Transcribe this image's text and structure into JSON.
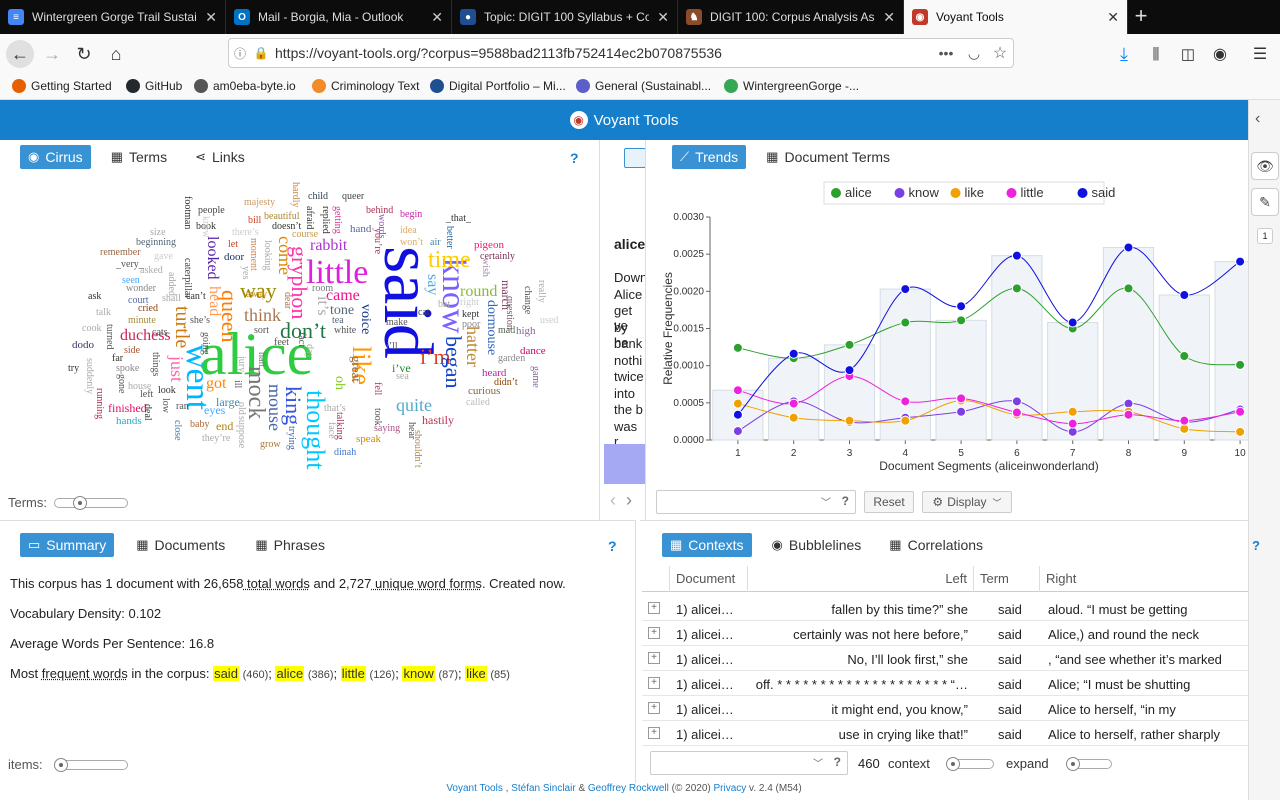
{
  "browser": {
    "tabs": [
      {
        "title": "Wintergreen Gorge Trail Sustain",
        "icon": "docs-icon",
        "color": "#4285f4",
        "glyph": "≡"
      },
      {
        "title": "Mail - Borgia, Mia - Outlook",
        "icon": "outlook-icon",
        "color": "#0072c6",
        "glyph": "O"
      },
      {
        "title": "Topic: DIGIT 100 Syllabus + Co",
        "icon": "globe-icon",
        "color": "#1d4f91",
        "glyph": "●"
      },
      {
        "title": "DIGIT 100: Corpus Analysis Ass",
        "icon": "horse-icon",
        "color": "#8a4b2a",
        "glyph": "♞"
      },
      {
        "title": "Voyant Tools",
        "icon": "voyant-icon",
        "color": "#c0392b",
        "glyph": "◉"
      }
    ],
    "url": "https://voyant-tools.org/?corpus=9588bad2113fb752414ec2b070875536",
    "bookmarks": [
      {
        "label": "Getting Started",
        "color": "#e66000"
      },
      {
        "label": "GitHub",
        "color": "#24292e"
      },
      {
        "label": "am0eba-byte.io",
        "color": "#555555"
      },
      {
        "label": "Criminology Text",
        "color": "#f28c28"
      },
      {
        "label": "Digital Portfolio – Mi...",
        "color": "#1d4f91"
      },
      {
        "label": "General (Sustainabl...",
        "color": "#5b5fc7"
      },
      {
        "label": "WintergreenGorge -...",
        "color": "#34a853"
      }
    ]
  },
  "voyant": {
    "title": "Voyant Tools",
    "accent": "#157fcc",
    "cirrus_panel": {
      "tabs": [
        "Cirrus",
        "Terms",
        "Links"
      ],
      "terms_label": "Terms:"
    },
    "reader_panel": {
      "heading": "alice",
      "lines": [
        "Down",
        "Alice",
        "get ve",
        "by he",
        "bank",
        "nothi",
        "twice",
        "into",
        "the b",
        "was r"
      ]
    },
    "trends_panel": {
      "tabs": [
        "Trends",
        "Document Terms"
      ],
      "reset_label": "Reset",
      "display_label": "Display"
    },
    "summary_panel": {
      "tabs": [
        "Summary",
        "Documents",
        "Phrases"
      ],
      "line1_a": "This corpus has 1 document with ",
      "line1_total": "26,658",
      "line1_b": " total words",
      "line1_c": " and ",
      "line1_unique": "2,727",
      "line1_d": " unique word forms",
      "line1_e": ". Created now.",
      "density_label": "Vocabulary Density:",
      "density_value": "0.102",
      "awps_label": "Average Words Per Sentence:",
      "awps_value": "16.8",
      "freq_a": "Most ",
      "freq_b": "frequent words",
      "freq_c": " in the corpus:",
      "freq_words": [
        {
          "word": "said",
          "count": "(460)"
        },
        {
          "word": "alice",
          "count": "(386)"
        },
        {
          "word": "little",
          "count": "(126)"
        },
        {
          "word": "know",
          "count": "(87)"
        },
        {
          "word": "like",
          "count": "(85)"
        }
      ],
      "items_label": "items:"
    },
    "contexts_panel": {
      "tabs": [
        "Contexts",
        "Bubblelines",
        "Correlations"
      ],
      "columns": [
        "Document",
        "Left",
        "Term",
        "Right"
      ],
      "rows": [
        {
          "doc": "1) alicei…",
          "left": "fallen by this time?” she",
          "term": "said",
          "right": "aloud. “I must be getting"
        },
        {
          "doc": "1) alicei…",
          "left": "certainly was not here before,”",
          "term": "said",
          "right": "Alice,) and round the neck"
        },
        {
          "doc": "1) alicei…",
          "left": "No, I’ll look first,” she",
          "term": "said",
          "right": ", “and see whether it’s marked"
        },
        {
          "doc": "1) alicei…",
          "left": "off. * * * * * * * * * * * * * * * * * * * * “…",
          "term": "said",
          "right": "Alice; “I must be shutting"
        },
        {
          "doc": "1) alicei…",
          "left": "it might end, you know,”",
          "term": "said",
          "right": "Alice to herself, “in my"
        },
        {
          "doc": "1) alicei…",
          "left": "use in crying like that!”",
          "term": "said",
          "right": "Alice to herself, rather sharply"
        }
      ],
      "count": "460",
      "context_label": "context",
      "expand_label": "expand"
    },
    "footer": {
      "a": "Voyant Tools",
      "b": " , ",
      "c": "Stéfan Sinclair",
      "d": " & ",
      "e": "Geoffrey Rockwell",
      "f": " (© 2020) ",
      "g": "Privacy",
      "h": " v. 2.4 (M54)"
    },
    "side_badge": "1"
  },
  "cirrus_words": [
    {
      "t": "said",
      "c": "#1010e0",
      "r": 90
    },
    {
      "t": "alice",
      "c": "#2ecc40",
      "r": 0
    },
    {
      "t": "went",
      "c": "#00b7ff",
      "r": 90
    },
    {
      "t": "little",
      "c": "#dd22dd",
      "r": 0
    },
    {
      "t": "know",
      "c": "#7b61ff",
      "r": 90
    },
    {
      "t": "like",
      "c": "#ff9900",
      "r": 90
    },
    {
      "t": "thought",
      "c": "#00c8ff",
      "r": 90
    },
    {
      "t": "king",
      "c": "#3355dd",
      "r": 90
    },
    {
      "t": "queen",
      "c": "#ff7b00",
      "r": 90
    },
    {
      "t": "time",
      "c": "#ffcc00",
      "r": 0
    },
    {
      "t": "way",
      "c": "#998800",
      "r": 0
    },
    {
      "t": "don’t",
      "c": "#227744",
      "r": 0
    },
    {
      "t": "mock",
      "c": "#777777",
      "r": 90
    },
    {
      "t": "turtle",
      "c": "#cc7711",
      "r": 90
    },
    {
      "t": "just",
      "c": "#ff66aa",
      "r": 90
    },
    {
      "t": "i’m",
      "c": "#dd4422",
      "r": 0
    },
    {
      "t": "began",
      "c": "#1144cc",
      "r": 90
    },
    {
      "t": "gryphon",
      "c": "#ff33aa",
      "r": 90
    },
    {
      "t": "hatter",
      "c": "#bb8833",
      "r": 90
    },
    {
      "t": "quite",
      "c": "#55aacc",
      "r": 0
    },
    {
      "t": "rabbit",
      "c": "#aa33cc",
      "r": 0
    },
    {
      "t": "mouse",
      "c": "#4466aa",
      "r": 90
    },
    {
      "t": "looked",
      "c": "#5522aa",
      "r": 90
    },
    {
      "t": "think",
      "c": "#aa7755",
      "r": 0
    },
    {
      "t": "round",
      "c": "#88bb33",
      "r": 0
    },
    {
      "t": "duchess",
      "c": "#cc2255",
      "r": 0
    },
    {
      "t": "came",
      "c": "#ee1188",
      "r": 0
    },
    {
      "t": "head",
      "c": "#ff9955",
      "r": 90
    },
    {
      "t": "dormouse",
      "c": "#3366bb",
      "r": 90
    },
    {
      "t": "voice",
      "c": "#113388",
      "r": 90
    },
    {
      "t": "tone",
      "c": "#556677",
      "r": 0
    },
    {
      "t": "say",
      "c": "#55aadd",
      "r": 90
    },
    {
      "t": "got",
      "c": "#ff8800",
      "r": 0
    },
    {
      "t": "oh",
      "c": "#88cc22",
      "r": 90
    },
    {
      "t": "come",
      "c": "#dd8800",
      "r": 90
    },
    {
      "t": "it’s",
      "c": "#aaaaaa",
      "r": 90
    },
    {
      "t": "great",
      "c": "#996633",
      "r": 90
    },
    {
      "t": "eyes",
      "c": "#44aaff",
      "r": 0
    },
    {
      "t": "large",
      "c": "#4488aa",
      "r": 0
    },
    {
      "t": "end",
      "c": "#aa8811",
      "r": 0
    },
    {
      "t": "march",
      "c": "#773355",
      "r": 90
    },
    {
      "t": "hastily",
      "c": "#bb3355",
      "r": 0
    },
    {
      "t": "finished",
      "c": "#dd1166",
      "r": 0
    },
    {
      "t": "hands",
      "c": "#22aacc",
      "r": 0
    },
    {
      "t": "baby",
      "c": "#aa6633",
      "r": 0
    },
    {
      "t": "grow",
      "c": "#aa7733",
      "r": 0
    },
    {
      "t": "speak",
      "c": "#cc8800",
      "r": 0
    },
    {
      "t": "dinah",
      "c": "#4477cc",
      "r": 0
    },
    {
      "t": "curious",
      "c": "#886633",
      "r": 0
    },
    {
      "t": "heard",
      "c": "#bb2299",
      "r": 0
    },
    {
      "t": "didn’t",
      "c": "#884400",
      "r": 0
    },
    {
      "t": "dance",
      "c": "#cc0066",
      "r": 0
    },
    {
      "t": "high",
      "c": "#886699",
      "r": 0
    },
    {
      "t": "kept",
      "c": "#333333",
      "r": 0
    },
    {
      "t": "pigeon",
      "c": "#ff1177",
      "r": 0
    },
    {
      "t": "certainly",
      "c": "#773355",
      "r": 0
    },
    {
      "t": "begin",
      "c": "#cc22aa",
      "r": 0
    },
    {
      "t": "idea",
      "c": "#ddaa66",
      "r": 0
    },
    {
      "t": "won’t",
      "c": "#ddaa66",
      "r": 0
    },
    {
      "t": "air",
      "c": "#4488aa",
      "r": 0
    },
    {
      "t": "_that_",
      "c": "#333333",
      "r": 0
    },
    {
      "t": "behind",
      "c": "#aa3355",
      "r": 0
    },
    {
      "t": "queer",
      "c": "#444444",
      "r": 0
    },
    {
      "t": "child",
      "c": "#334455",
      "r": 0
    },
    {
      "t": "words",
      "c": "#8855aa",
      "r": 90
    },
    {
      "t": "hand",
      "c": "#556699",
      "r": 0
    },
    {
      "t": "course",
      "c": "#cc9944",
      "r": 0
    },
    {
      "t": "doesn’t",
      "c": "#333333",
      "r": 0
    },
    {
      "t": "beautiful",
      "c": "#aa8833",
      "r": 0
    },
    {
      "t": "majesty",
      "c": "#cc9966",
      "r": 0
    },
    {
      "t": "people",
      "c": "#444444",
      "r": 0
    },
    {
      "t": "book",
      "c": "#333333",
      "r": 0
    },
    {
      "t": "let",
      "c": "#cc4422",
      "r": 0
    },
    {
      "t": "door",
      "c": "#113366",
      "r": 0
    },
    {
      "t": "beginning",
      "c": "#556677",
      "r": 0
    },
    {
      "t": "size",
      "c": "#aaaaaa",
      "r": 0
    },
    {
      "t": "remember",
      "c": "#996644",
      "r": 0
    },
    {
      "t": "asked",
      "c": "#aaaaaa",
      "r": 0
    },
    {
      "t": "court",
      "c": "#5566aa",
      "r": 0
    },
    {
      "t": "ask",
      "c": "#333333",
      "r": 0
    },
    {
      "t": "seen",
      "c": "#44aaff",
      "r": 0
    },
    {
      "t": "wonder",
      "c": "#888888",
      "r": 0
    },
    {
      "t": "minute",
      "c": "#aa8833",
      "r": 0
    },
    {
      "t": "side",
      "c": "#aa5533",
      "r": 0
    },
    {
      "t": "cried",
      "c": "#884411",
      "r": 0
    },
    {
      "t": "look",
      "c": "#333333",
      "r": 0
    },
    {
      "t": "dodo",
      "c": "#333366",
      "r": 0
    },
    {
      "t": "try",
      "c": "#333333",
      "r": 0
    },
    {
      "t": "far",
      "c": "#333333",
      "r": 0
    },
    {
      "t": "spoke",
      "c": "#888888",
      "r": 0
    },
    {
      "t": "house",
      "c": "#aaaaaa",
      "r": 0
    },
    {
      "t": "make",
      "c": "#555555",
      "r": 0
    },
    {
      "t": "white",
      "c": "#555555",
      "r": 0
    },
    {
      "t": "cat",
      "c": "#444444",
      "r": 0
    },
    {
      "t": "i’ve",
      "c": "#228833",
      "r": 0
    },
    {
      "t": "i’ll",
      "c": "#555555",
      "r": 0
    },
    {
      "t": "saying",
      "c": "#aa5588",
      "r": 0
    },
    {
      "t": "question",
      "c": "#775566",
      "r": 90
    },
    {
      "t": "mad",
      "c": "#556655",
      "r": 0
    },
    {
      "t": "called",
      "c": "#bbbbbb",
      "r": 0
    },
    {
      "t": "garden",
      "c": "#888888",
      "r": 0
    },
    {
      "t": "change",
      "c": "#555555",
      "r": 90
    },
    {
      "t": "game",
      "c": "#886699",
      "r": 90
    },
    {
      "t": "really",
      "c": "#aaaaaa",
      "r": 90
    },
    {
      "t": "used",
      "c": "#cccccc",
      "r": 0
    },
    {
      "t": "wish",
      "c": "#aa88aa",
      "r": 90
    },
    {
      "t": "better",
      "c": "#2266aa",
      "r": 90
    },
    {
      "t": "sort",
      "c": "#555555",
      "r": 0
    },
    {
      "t": "hall",
      "c": "#777777",
      "r": 90
    },
    {
      "t": "feet",
      "c": "#555555",
      "r": 0
    },
    {
      "t": "talking",
      "c": "#aa3355",
      "r": 90
    },
    {
      "t": "trying",
      "c": "#4466aa",
      "r": 90
    },
    {
      "t": "close",
      "c": "#4477aa",
      "r": 90
    },
    {
      "t": "deal",
      "c": "#333333",
      "r": 90
    },
    {
      "t": "caterpillar",
      "c": "#444444",
      "r": 90
    },
    {
      "t": "footman",
      "c": "#333333",
      "r": 90
    },
    {
      "t": "afraid",
      "c": "#333333",
      "r": 90
    },
    {
      "t": "replied",
      "c": "#333333",
      "r": 90
    },
    {
      "t": "getting",
      "c": "#dd3399",
      "r": 90
    },
    {
      "t": "looking",
      "c": "#aaaaaa",
      "r": 90
    },
    {
      "t": "moment",
      "c": "#cc8855",
      "r": 90
    },
    {
      "t": "away",
      "c": "#cc8800",
      "r": 0
    },
    {
      "t": "room",
      "c": "#777777",
      "r": 0
    },
    {
      "t": "tea",
      "c": "#556677",
      "r": 0
    },
    {
      "t": "poor",
      "c": "#888888",
      "r": 0
    },
    {
      "t": "shall",
      "c": "#aaaaaa",
      "r": 0
    },
    {
      "t": "can’t",
      "c": "#333333",
      "r": 0
    },
    {
      "t": "she’s",
      "c": "#555555",
      "r": 0
    },
    {
      "t": "they’re",
      "c": "#aaaaaa",
      "r": 0
    },
    {
      "t": "left",
      "c": "#555555",
      "r": 0
    },
    {
      "t": "turned",
      "c": "#555555",
      "r": 90
    },
    {
      "t": "gone",
      "c": "#555555",
      "r": 90
    },
    {
      "t": "running",
      "c": "#aa3355",
      "r": 90
    },
    {
      "t": "suddenly",
      "c": "#aaaaaa",
      "r": 90
    },
    {
      "t": "things",
      "c": "#555555",
      "r": 90
    },
    {
      "t": "going",
      "c": "#555555",
      "r": 90
    },
    {
      "t": "talk",
      "c": "#aaaaaa",
      "r": 0
    },
    {
      "t": "cook",
      "c": "#aaaaaa",
      "r": 0
    },
    {
      "t": "bill",
      "c": "#cc4422",
      "r": 0
    },
    {
      "t": "there’s",
      "c": "#cccccc",
      "r": 0
    },
    {
      "t": "_very_",
      "c": "#555555",
      "r": 0
    },
    {
      "t": "gave",
      "c": "#cccccc",
      "r": 0
    },
    {
      "t": "hardly",
      "c": "#cc8844",
      "r": 90
    },
    {
      "t": "ran",
      "c": "#555555",
      "r": 0
    },
    {
      "t": "cats",
      "c": "#555555",
      "r": 0
    },
    {
      "t": "low",
      "c": "#555555",
      "r": 90
    },
    {
      "t": "face",
      "c": "#aaaaaa",
      "r": 90
    },
    {
      "t": "fell",
      "c": "#aa3355",
      "r": 90
    },
    {
      "t": "you’re",
      "c": "#aa3355",
      "r": 90
    },
    {
      "t": "bat",
      "c": "#aaaaaa",
      "r": 0
    },
    {
      "t": "knew",
      "c": "#cccccc",
      "r": 90
    },
    {
      "t": "shouldn’t",
      "c": "#aa8855",
      "r": 90
    },
    {
      "t": "hear",
      "c": "#555555",
      "r": 90
    },
    {
      "t": "suppose",
      "c": "#aaaaaa",
      "r": 90
    },
    {
      "t": "dear",
      "c": "#aa7755",
      "r": 90
    },
    {
      "t": "took",
      "c": "#555555",
      "r": 90
    },
    {
      "t": "right",
      "c": "#cccccc",
      "r": 0
    },
    {
      "t": "that’s",
      "c": "#aaaaaa",
      "r": 0
    },
    {
      "t": "old",
      "c": "#aaaaaa",
      "r": 90
    },
    {
      "t": "sea",
      "c": "#aaaaaa",
      "r": 0
    },
    {
      "t": "added",
      "c": "#aaaaaa",
      "r": 90
    },
    {
      "t": "fact",
      "c": "#555555",
      "r": 90
    },
    {
      "t": "yes",
      "c": "#aaaaaa",
      "r": 90
    },
    {
      "t": "day",
      "c": "#aaaaaa",
      "r": 90
    },
    {
      "t": "ill",
      "c": "#555555",
      "r": 90
    },
    {
      "t": "jury",
      "c": "#aaaaaa",
      "r": 90
    }
  ],
  "chart_data": {
    "type": "line",
    "x": [
      1,
      2,
      3,
      4,
      5,
      6,
      7,
      8,
      9,
      10
    ],
    "xlabel": "Document Segments (aliceinwonderland)",
    "ylabel": "Relative Frequencies",
    "ylim": [
      0,
      0.003
    ],
    "yticks": [
      "0.0000",
      "0.0005",
      "0.0010",
      "0.0015",
      "0.0020",
      "0.0025",
      "0.0030"
    ],
    "legend_position": "top",
    "series": [
      {
        "name": "alice",
        "color": "#2ca02c",
        "values": [
          0.00124,
          0.0011,
          0.00128,
          0.00158,
          0.00161,
          0.00204,
          0.0015,
          0.00204,
          0.00113,
          0.00101
        ]
      },
      {
        "name": "know",
        "color": "#7b3fe4",
        "values": [
          0.00012,
          0.00052,
          0.00024,
          0.0003,
          0.00038,
          0.00052,
          0.00011,
          0.00049,
          0.00024,
          0.00041
        ]
      },
      {
        "name": "like",
        "color": "#f0a000",
        "values": [
          0.00049,
          0.0003,
          0.00026,
          0.00026,
          0.00053,
          0.00034,
          0.00038,
          0.00038,
          0.00015,
          0.00011
        ]
      },
      {
        "name": "little",
        "color": "#ee22dd",
        "values": [
          0.00067,
          0.00049,
          0.00086,
          0.00052,
          0.00056,
          0.00037,
          0.00022,
          0.00034,
          0.00026,
          0.00038
        ]
      },
      {
        "name": "said",
        "color": "#1010e0",
        "values": [
          0.00034,
          0.00116,
          0.00094,
          0.00203,
          0.0018,
          0.00248,
          0.00158,
          0.00259,
          0.00195,
          0.0024
        ]
      }
    ],
    "bars": [
      0.00067,
      0.0011,
      0.00128,
      0.00203,
      0.00161,
      0.00248,
      0.00158,
      0.00259,
      0.00195,
      0.0024
    ]
  }
}
